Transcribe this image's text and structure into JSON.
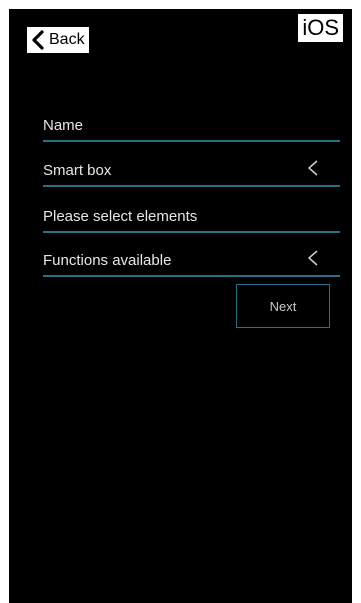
{
  "os_label": "iOS",
  "nav": {
    "back_label": "Back"
  },
  "form": {
    "name_label": "Name",
    "smart_box_label": "Smart box",
    "elements_label": "Please select elements",
    "functions_label": "Functions available",
    "next_label": "Next"
  },
  "colors": {
    "background": "#000000",
    "accent_underline": "#2a6f86",
    "text": "#e6e6e6"
  }
}
